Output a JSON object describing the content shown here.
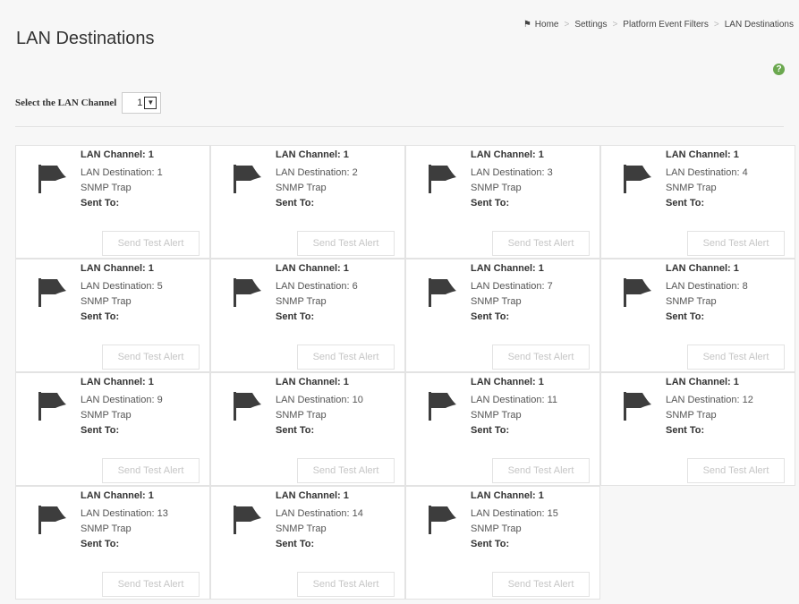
{
  "page": {
    "title": "LAN Destinations"
  },
  "breadcrumb": [
    "Home",
    "Settings",
    "Platform Event Filters",
    "LAN Destinations"
  ],
  "channel_select": {
    "label": "Select the LAN Channel",
    "value": "1"
  },
  "cards": [
    {
      "channel": "LAN Channel: 1",
      "destination": "LAN Destination: 1",
      "type": "SNMP Trap",
      "sent_to": "Sent To:",
      "button": "Send Test Alert"
    },
    {
      "channel": "LAN Channel: 1",
      "destination": "LAN Destination: 2",
      "type": "SNMP Trap",
      "sent_to": "Sent To:",
      "button": "Send Test Alert"
    },
    {
      "channel": "LAN Channel: 1",
      "destination": "LAN Destination: 3",
      "type": "SNMP Trap",
      "sent_to": "Sent To:",
      "button": "Send Test Alert"
    },
    {
      "channel": "LAN Channel: 1",
      "destination": "LAN Destination: 4",
      "type": "SNMP Trap",
      "sent_to": "Sent To:",
      "button": "Send Test Alert"
    },
    {
      "channel": "LAN Channel: 1",
      "destination": "LAN Destination: 5",
      "type": "SNMP Trap",
      "sent_to": "Sent To:",
      "button": "Send Test Alert"
    },
    {
      "channel": "LAN Channel: 1",
      "destination": "LAN Destination: 6",
      "type": "SNMP Trap",
      "sent_to": "Sent To:",
      "button": "Send Test Alert"
    },
    {
      "channel": "LAN Channel: 1",
      "destination": "LAN Destination: 7",
      "type": "SNMP Trap",
      "sent_to": "Sent To:",
      "button": "Send Test Alert"
    },
    {
      "channel": "LAN Channel: 1",
      "destination": "LAN Destination: 8",
      "type": "SNMP Trap",
      "sent_to": "Sent To:",
      "button": "Send Test Alert"
    },
    {
      "channel": "LAN Channel: 1",
      "destination": "LAN Destination: 9",
      "type": "SNMP Trap",
      "sent_to": "Sent To:",
      "button": "Send Test Alert"
    },
    {
      "channel": "LAN Channel: 1",
      "destination": "LAN Destination: 10",
      "type": "SNMP Trap",
      "sent_to": "Sent To:",
      "button": "Send Test Alert"
    },
    {
      "channel": "LAN Channel: 1",
      "destination": "LAN Destination: 11",
      "type": "SNMP Trap",
      "sent_to": "Sent To:",
      "button": "Send Test Alert"
    },
    {
      "channel": "LAN Channel: 1",
      "destination": "LAN Destination: 12",
      "type": "SNMP Trap",
      "sent_to": "Sent To:",
      "button": "Send Test Alert"
    },
    {
      "channel": "LAN Channel: 1",
      "destination": "LAN Destination: 13",
      "type": "SNMP Trap",
      "sent_to": "Sent To:",
      "button": "Send Test Alert"
    },
    {
      "channel": "LAN Channel: 1",
      "destination": "LAN Destination: 14",
      "type": "SNMP Trap",
      "sent_to": "Sent To:",
      "button": "Send Test Alert"
    },
    {
      "channel": "LAN Channel: 1",
      "destination": "LAN Destination: 15",
      "type": "SNMP Trap",
      "sent_to": "Sent To:",
      "button": "Send Test Alert"
    }
  ],
  "icons": {
    "card": "flag-icon",
    "help": "help-icon",
    "home": "home-icon"
  },
  "colors": {
    "help": "#6ba84f",
    "flag": "#3d3d3d"
  }
}
